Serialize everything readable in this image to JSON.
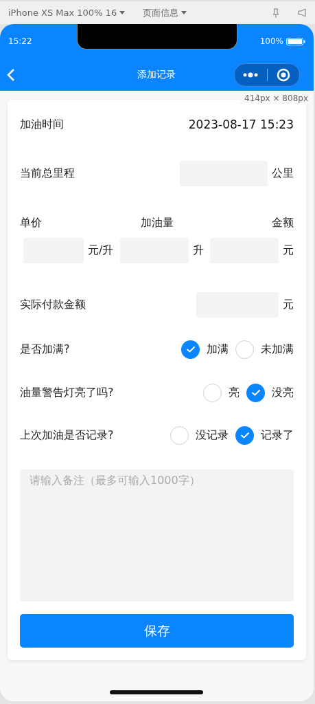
{
  "devtools_bar": {
    "device": "iPhone XS Max 100% 16",
    "page_info": "页面信息"
  },
  "status_bar": {
    "time": "15:22",
    "battery": "100%"
  },
  "nav_bar": {
    "title": "添加记录"
  },
  "size_hint": "414px × 808px",
  "form": {
    "refuel_time": {
      "label": "加油时间",
      "value": "2023-08-17 15:23"
    },
    "mileage": {
      "label": "当前总里程",
      "unit": "公里"
    },
    "price_fields": [
      {
        "label": "单价",
        "unit": "元/升"
      },
      {
        "label": "加油量",
        "unit": "升"
      },
      {
        "label": "金额",
        "unit": "元"
      }
    ],
    "paid_amount": {
      "label": "实际付款金额",
      "unit": "元"
    },
    "questions": [
      {
        "label": "是否加满?",
        "options": [
          {
            "label": "加满",
            "selected": true
          },
          {
            "label": "未加满",
            "selected": false
          }
        ]
      },
      {
        "label": "油量警告灯亮了吗?",
        "options": [
          {
            "label": "亮",
            "selected": false
          },
          {
            "label": "没亮",
            "selected": true
          }
        ]
      },
      {
        "label": "上次加油是否记录?",
        "options": [
          {
            "label": "没记录",
            "selected": false
          },
          {
            "label": "记录了",
            "selected": true
          }
        ]
      }
    ],
    "remark": {
      "placeholder": "请输入备注（最多可输入1000字）"
    },
    "save_button": "保存"
  }
}
